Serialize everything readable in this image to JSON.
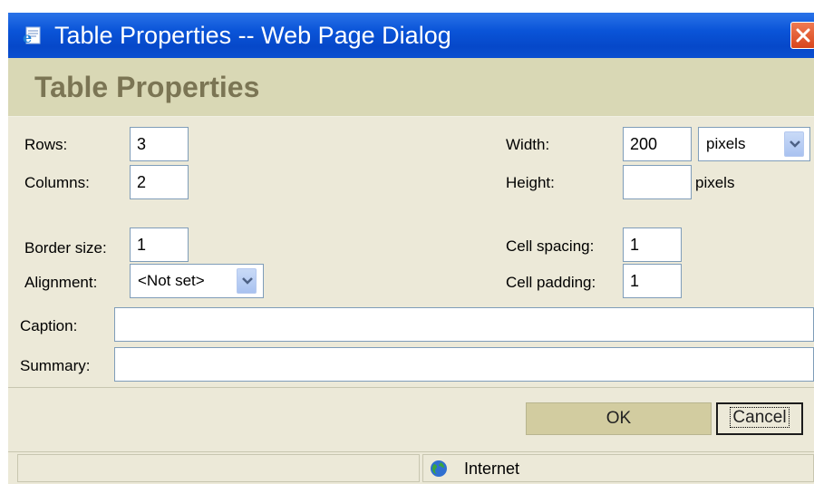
{
  "window": {
    "title": "Table Properties -- Web Page Dialog",
    "icon": "ie-page-icon",
    "close_icon": "close-icon"
  },
  "header": {
    "title": "Table Properties"
  },
  "form": {
    "rows": {
      "label": "Rows:",
      "value": "3"
    },
    "columns": {
      "label": "Columns:",
      "value": "2"
    },
    "width": {
      "label": "Width:",
      "value": "200",
      "unit": "pixels"
    },
    "height": {
      "label": "Height:",
      "value": "",
      "unit": "pixels"
    },
    "border_size": {
      "label": "Border size:",
      "value": "1"
    },
    "alignment": {
      "label": "Alignment:",
      "value": "<Not set>"
    },
    "cell_spacing": {
      "label": "Cell spacing:",
      "value": "1"
    },
    "cell_padding": {
      "label": "Cell padding:",
      "value": "1"
    },
    "caption": {
      "label": "Caption:",
      "value": ""
    },
    "summary": {
      "label": "Summary:",
      "value": ""
    }
  },
  "buttons": {
    "ok": "OK",
    "cancel": "Cancel"
  },
  "statusbar": {
    "zone": "Internet",
    "zone_icon": "globe-icon"
  },
  "colors": {
    "titlebar": "#0a54d8",
    "dialog_bg": "#ece9d8",
    "header_bg": "#d9d8b5",
    "header_text": "#7b7554"
  }
}
